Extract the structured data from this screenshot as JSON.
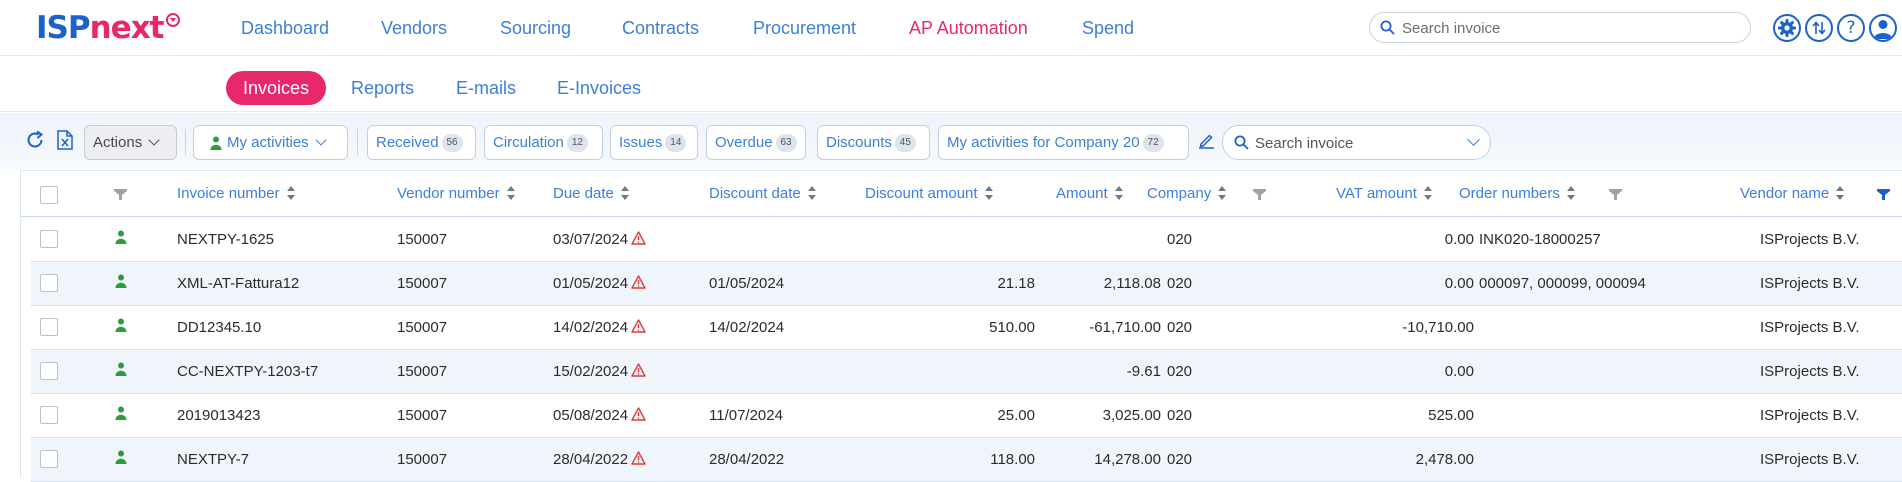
{
  "logo": {
    "part1": "ISP",
    "part2": "next"
  },
  "nav": {
    "items": [
      {
        "label": "Dashboard"
      },
      {
        "label": "Vendors"
      },
      {
        "label": "Sourcing"
      },
      {
        "label": "Contracts"
      },
      {
        "label": "Procurement"
      },
      {
        "label": "AP Automation"
      },
      {
        "label": "Spend"
      }
    ],
    "active": "AP Automation",
    "search_placeholder": "Search invoice"
  },
  "subnav": {
    "items": [
      {
        "label": "Invoices"
      },
      {
        "label": "Reports"
      },
      {
        "label": "E-mails"
      },
      {
        "label": "E-Invoices"
      }
    ],
    "active": "Invoices"
  },
  "toolbar": {
    "actions_label": "Actions",
    "activities_label": "My activities",
    "filters": [
      {
        "label": "Received",
        "count": "56"
      },
      {
        "label": "Circulation",
        "count": "12"
      },
      {
        "label": "Issues",
        "count": "14"
      },
      {
        "label": "Overdue",
        "count": "63"
      },
      {
        "label": "Discounts",
        "count": "45"
      },
      {
        "label": "My activities for Company 20",
        "count": "72"
      }
    ],
    "search_placeholder": "Search invoice"
  },
  "table": {
    "columns": [
      {
        "label": "Invoice number"
      },
      {
        "label": "Vendor number"
      },
      {
        "label": "Due date"
      },
      {
        "label": "Discount date"
      },
      {
        "label": "Discount amount"
      },
      {
        "label": "Amount"
      },
      {
        "label": "Company"
      },
      {
        "label": "VAT amount"
      },
      {
        "label": "Order numbers"
      },
      {
        "label": "Vendor name"
      }
    ],
    "rows": [
      {
        "invoice": "NEXTPY-1625",
        "vendor_no": "150007",
        "due": "03/07/2024",
        "disc_date": "",
        "disc_amount": "",
        "amount": "",
        "company": "020",
        "vat": "0.00",
        "orders": "INK020-18000257",
        "vendor_name": "ISProjects B.V."
      },
      {
        "invoice": "XML-AT-Fattura12",
        "vendor_no": "150007",
        "due": "01/05/2024",
        "disc_date": "01/05/2024",
        "disc_amount": "21.18",
        "amount": "2,118.08",
        "company": "020",
        "vat": "0.00",
        "orders": "000097, 000099, 000094",
        "vendor_name": "ISProjects B.V."
      },
      {
        "invoice": "DD12345.10",
        "vendor_no": "150007",
        "due": "14/02/2024",
        "disc_date": "14/02/2024",
        "disc_amount": "510.00",
        "amount": "-61,710.00",
        "company": "020",
        "vat": "-10,710.00",
        "orders": "",
        "vendor_name": "ISProjects B.V."
      },
      {
        "invoice": "CC-NEXTPY-1203-t7",
        "vendor_no": "150007",
        "due": "15/02/2024",
        "disc_date": "",
        "disc_amount": "",
        "amount": "-9.61",
        "company": "020",
        "vat": "0.00",
        "orders": "",
        "vendor_name": "ISProjects B.V."
      },
      {
        "invoice": "2019013423",
        "vendor_no": "150007",
        "due": "05/08/2024",
        "disc_date": "11/07/2024",
        "disc_amount": "25.00",
        "amount": "3,025.00",
        "company": "020",
        "vat": "525.00",
        "orders": "",
        "vendor_name": "ISProjects B.V."
      },
      {
        "invoice": "NEXTPY-7",
        "vendor_no": "150007",
        "due": "28/04/2022",
        "disc_date": "28/04/2022",
        "disc_amount": "118.00",
        "amount": "14,278.00",
        "company": "020",
        "vat": "2,478.00",
        "orders": "",
        "vendor_name": "ISProjects B.V."
      }
    ]
  },
  "colors": {
    "brand_blue": "#1b62c9",
    "brand_pink": "#e8286d",
    "link": "#3c7fd8",
    "status_green": "#2e9b3f",
    "warning_red": "#e03a3a"
  },
  "icons": [
    "search-icon",
    "settings-icon",
    "sort-icon",
    "help-icon",
    "user-icon",
    "refresh-icon",
    "excel-export-icon",
    "person-icon",
    "edit-icon",
    "filter-icon",
    "warning-icon"
  ]
}
